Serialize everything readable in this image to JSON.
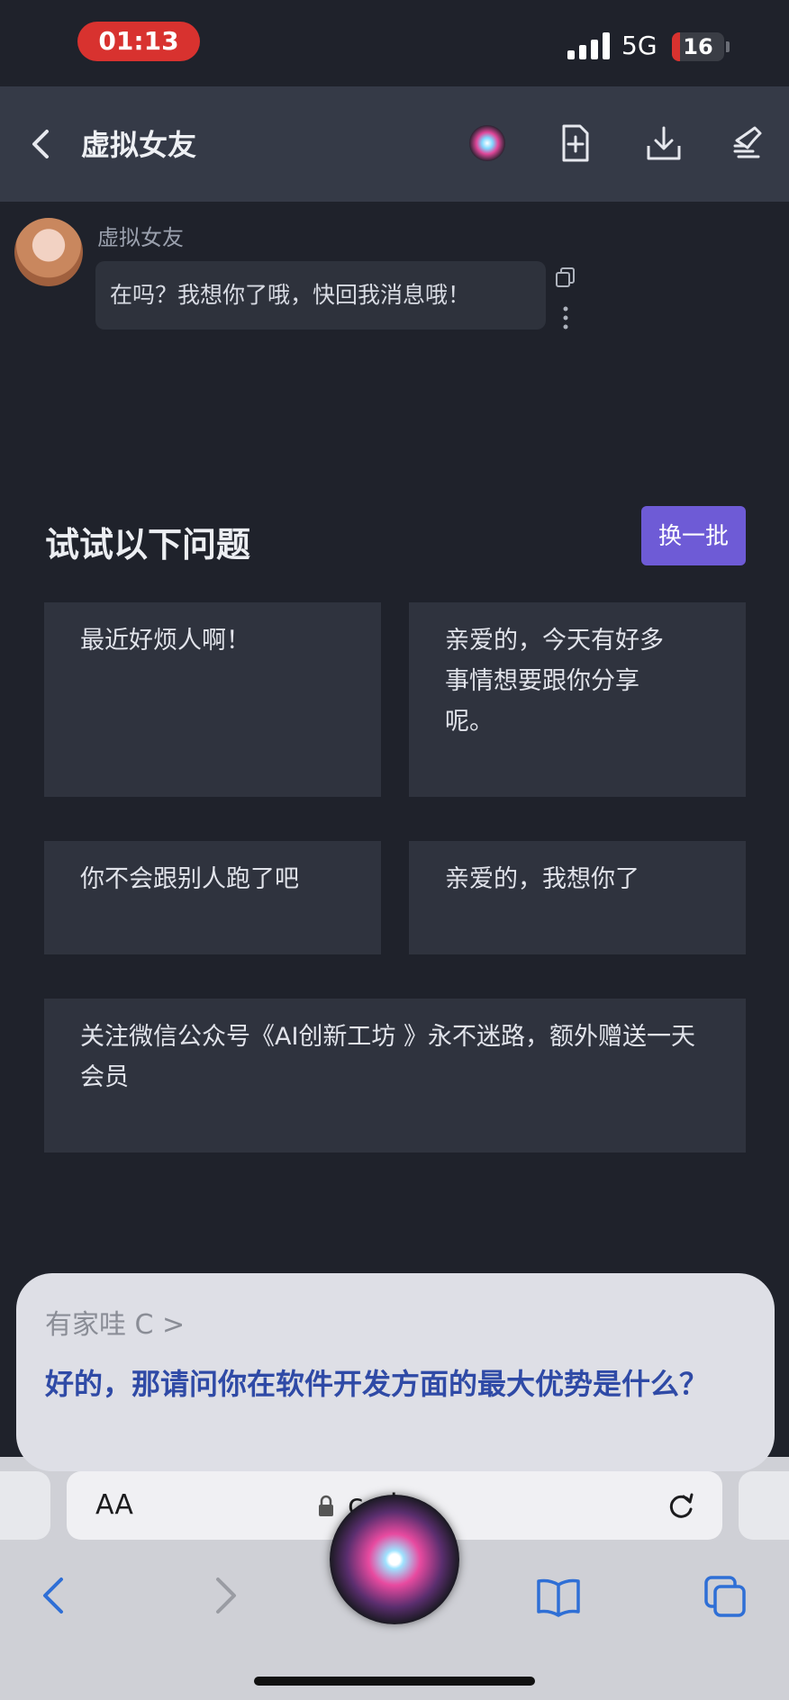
{
  "status_bar": {
    "time": "01:13",
    "network": "5G",
    "battery": "16",
    "battery_level": 0.16
  },
  "header": {
    "title": "虚拟女友"
  },
  "chat": {
    "sender": "虚拟女友",
    "message": "在吗？我想你了哦，快回我消息哦！"
  },
  "suggestions": {
    "title": "试试以下问题",
    "refresh_label": "换一批",
    "items": [
      "最近好烦人啊！",
      "亲爱的，今天有好多事情想要跟你分享呢。",
      "你不会跟别人跑了吧",
      "亲爱的，我想你了",
      "关注微信公众号《AI创新工坊 》永不迷路，额外赠送一天会员"
    ]
  },
  "siri": {
    "subtitle": "有家哇 C >",
    "text": "好的，那请问你在软件开发方面的最大优势是什么？"
  },
  "browser": {
    "aa_label": "AA",
    "url": "c        vip"
  },
  "colors": {
    "accent": "#6e5bd6",
    "background": "#1f222b",
    "card": "#2f333e",
    "siri_text": "#2f4aa6"
  }
}
